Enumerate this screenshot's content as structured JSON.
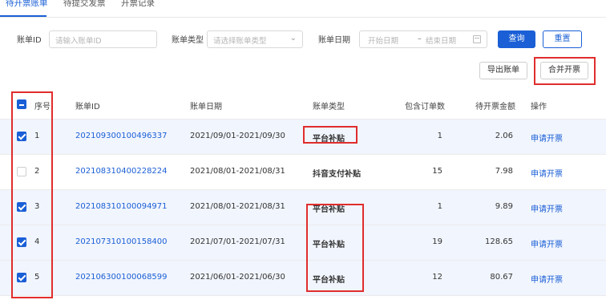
{
  "tabs": [
    {
      "label": "待开票账单",
      "active": true
    },
    {
      "label": "待提交发票",
      "active": false
    },
    {
      "label": "开票记录",
      "active": false
    }
  ],
  "filters": {
    "bill_id_label": "账单ID",
    "bill_id_placeholder": "请输入账单ID",
    "bill_type_label": "账单类型",
    "bill_type_placeholder": "请选择账单类型",
    "bill_date_label": "账单日期",
    "start_placeholder": "开始日期",
    "range_separator": "–",
    "end_placeholder": "结束日期",
    "query_button": "查询",
    "reset_button": "重置"
  },
  "actions": {
    "export_button": "导出账单",
    "merge_button": "合并开票"
  },
  "columns": [
    "序号",
    "账单ID",
    "账单日期",
    "账单类型",
    "包含订单数",
    "待开票金额",
    "操作"
  ],
  "rows": [
    {
      "index": "1",
      "bill_id": "202109300100496337",
      "date": "2021/09/01-2021/09/30",
      "type": "平台补贴",
      "orders": "1",
      "amount": "2.06",
      "action": "申请开票",
      "checked": true
    },
    {
      "index": "2",
      "bill_id": "202108310400228224",
      "date": "2021/08/01-2021/08/31",
      "type": "抖音支付补贴",
      "orders": "15",
      "amount": "7.98",
      "action": "申请开票",
      "checked": false
    },
    {
      "index": "3",
      "bill_id": "202108310100094971",
      "date": "2021/08/01-2021/08/31",
      "type": "平台补贴",
      "orders": "1",
      "amount": "9.89",
      "action": "申请开票",
      "checked": true
    },
    {
      "index": "4",
      "bill_id": "202107310100158400",
      "date": "2021/07/01-2021/07/31",
      "type": "平台补贴",
      "orders": "19",
      "amount": "128.65",
      "action": "申请开票",
      "checked": true
    },
    {
      "index": "5",
      "bill_id": "202106300100068599",
      "date": "2021/06/01-2021/06/30",
      "type": "平台补贴",
      "orders": "12",
      "amount": "80.67",
      "action": "申请开票",
      "checked": true
    }
  ],
  "colors": {
    "primary": "#1a5fd6",
    "annotation": "#e02d2d",
    "selected_row": "#f1f5fd"
  }
}
